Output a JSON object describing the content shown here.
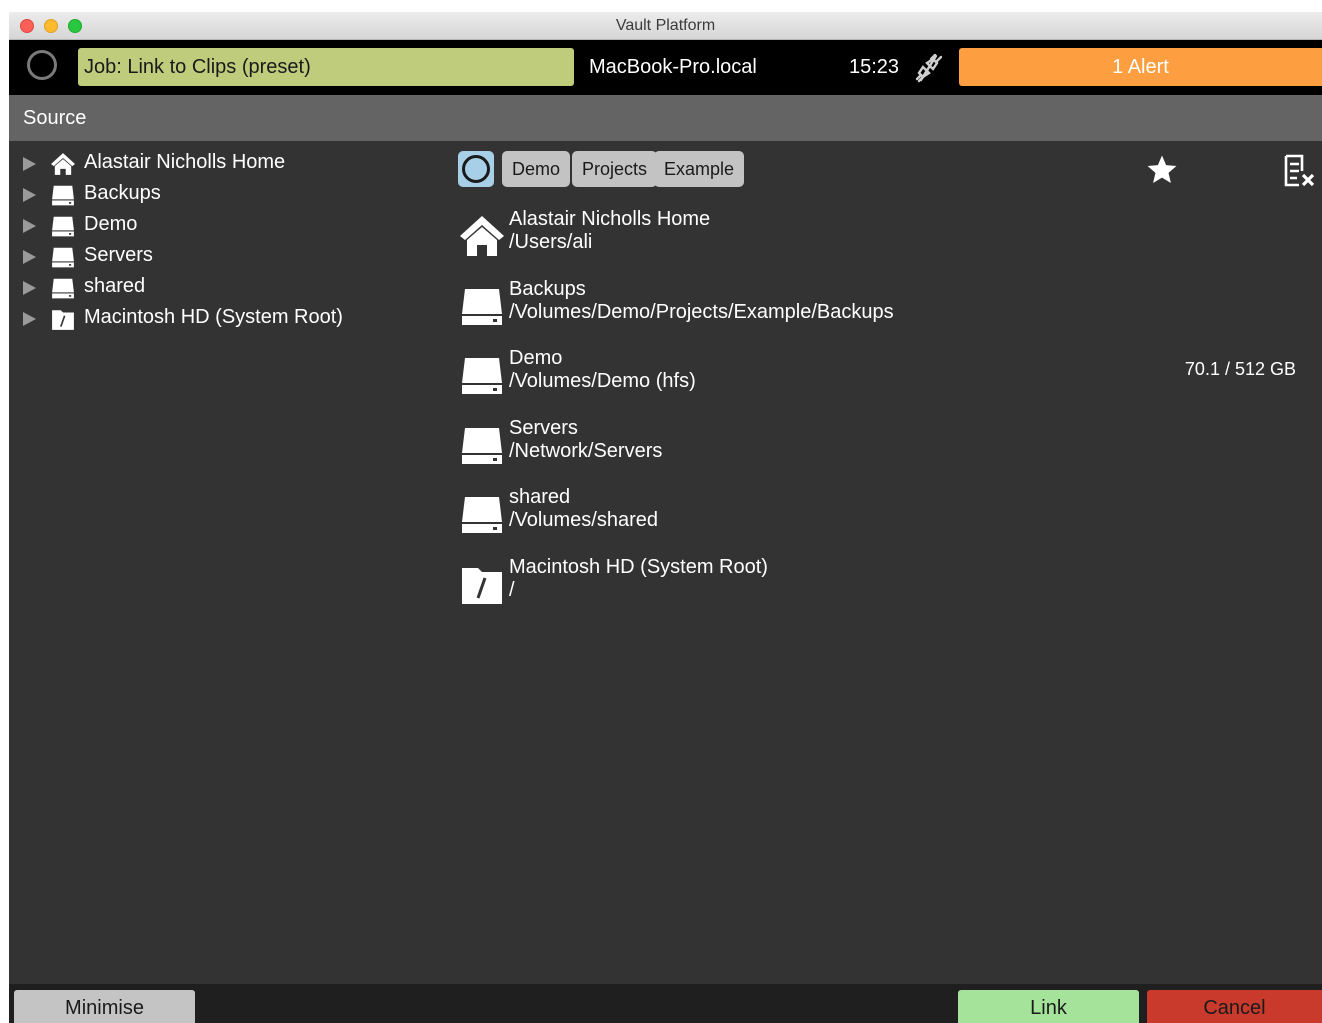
{
  "window": {
    "title": "Vault Platform"
  },
  "topbar": {
    "job_label": "Job: Link to Clips (preset)",
    "host": "MacBook-Pro.local",
    "time": "15:23",
    "alert_label": "1 Alert",
    "colors": {
      "job": "#bfcc7c",
      "alert": "#fd9f40"
    }
  },
  "section": {
    "title": "Source"
  },
  "tree": {
    "items": [
      {
        "label": "Alastair Nicholls Home",
        "icon": "home-icon"
      },
      {
        "label": "Backups",
        "icon": "drive-icon"
      },
      {
        "label": "Demo",
        "icon": "drive-icon"
      },
      {
        "label": "Servers",
        "icon": "drive-icon"
      },
      {
        "label": "shared",
        "icon": "drive-icon"
      },
      {
        "label": "Macintosh HD (System Root)",
        "icon": "root-folder-icon"
      }
    ]
  },
  "breadcrumbs": [
    "Demo",
    "Projects",
    "Example"
  ],
  "volumes": [
    {
      "name": "Alastair Nicholls Home",
      "path": "/Users/ali",
      "icon": "home-icon",
      "usage": ""
    },
    {
      "name": "Backups",
      "path": "/Volumes/Demo/Projects/Example/Backups",
      "icon": "drive-icon",
      "usage": ""
    },
    {
      "name": "Demo",
      "path": "/Volumes/Demo (hfs)",
      "icon": "drive-icon",
      "usage": "70.1 / 512 GB"
    },
    {
      "name": "Servers",
      "path": "/Network/Servers",
      "icon": "drive-icon",
      "usage": ""
    },
    {
      "name": "shared",
      "path": "/Volumes/shared",
      "icon": "drive-icon",
      "usage": ""
    },
    {
      "name": "Macintosh HD (System Root)",
      "path": "/",
      "icon": "root-folder-icon",
      "usage": ""
    }
  ],
  "footer": {
    "minimise_label": "Minimise",
    "link_label": "Link",
    "cancel_label": "Cancel",
    "colors": {
      "link": "#a6e39a",
      "cancel": "#c93a2c"
    }
  }
}
